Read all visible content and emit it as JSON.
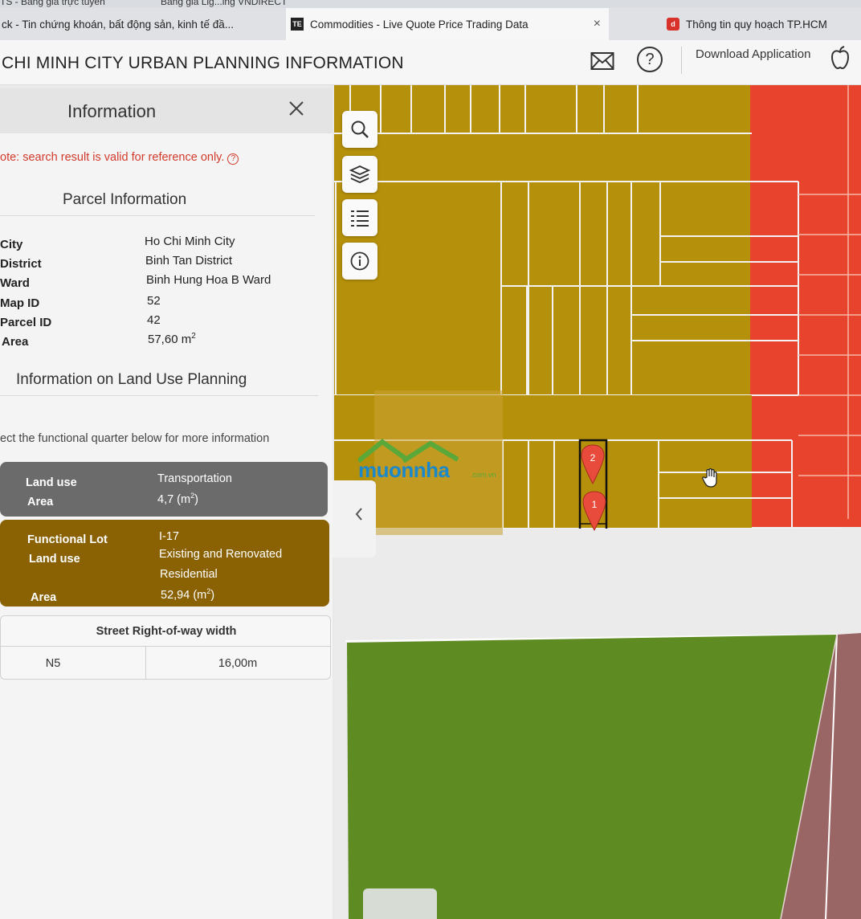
{
  "browser": {
    "top_tabs": [
      "TS - Bảng giá trực tuyến",
      "Bảng giá Lig...ing VNDIRECT"
    ],
    "tabs": [
      {
        "label": "ck - Tin chứng khoán, bất động sản, kinh tế đầ...",
        "favicon": "",
        "active": false
      },
      {
        "label": "Commodities - Live Quote Price Trading Data",
        "favicon": "TE",
        "active": true,
        "close": "×"
      },
      {
        "label": "Thông tin quy hoạch TP.HCM",
        "favicon": "d",
        "active": false
      }
    ]
  },
  "header": {
    "title": "CHI MINH CITY URBAN PLANNING INFORMATION",
    "download_label": "Download Application",
    "icons": [
      "mail-icon",
      "help-icon",
      "apple-icon"
    ]
  },
  "panel": {
    "title": "Information",
    "note": "ote: search result is valid for reference only.",
    "parcel_section": "Parcel Information",
    "parcel": [
      {
        "label": "City",
        "value": "Ho Chi Minh City"
      },
      {
        "label": "District",
        "value": "Binh Tan District"
      },
      {
        "label": "Ward",
        "value": "Binh Hung Hoa B Ward"
      },
      {
        "label": "Map ID",
        "value": "52"
      },
      {
        "label": "Parcel ID",
        "value": "42"
      },
      {
        "label": "Area",
        "value": "57,60 m",
        "sup": "2"
      }
    ],
    "planning_section": "Information on Land Use Planning",
    "hint": "ect the functional quarter below for more information",
    "transport_card": {
      "land_use_label": "Land use",
      "land_use_value": "Transportation",
      "area_label": "Area",
      "area_value": "4,7 (m",
      "area_sup": "2",
      "area_close": ")"
    },
    "residential_card": {
      "lot_label": "Functional Lot",
      "lot_value": "I-17",
      "land_use_label": "Land use",
      "land_use_value_1": "Existing and Renovated",
      "land_use_value_2": "Residential",
      "area_label": "Area",
      "area_value": "52,94 (m",
      "area_sup": "2",
      "area_close": ")"
    },
    "street_table": {
      "header": "Street Right-of-way width",
      "street": "N5",
      "width": "16,00m"
    }
  },
  "map": {
    "markers": [
      "2",
      "1"
    ],
    "watermark": "muonnha",
    "watermark_sub": ".com.vn",
    "colors": {
      "residential": "#b5900b",
      "commercial_red": "#e8432c",
      "park_green": "#5e8c22",
      "pink": "#9a6565",
      "road": "#ebebeb",
      "marker": "#e84b3c"
    }
  },
  "map_tools": [
    "search-icon",
    "layers-icon",
    "list-icon",
    "info-icon"
  ]
}
